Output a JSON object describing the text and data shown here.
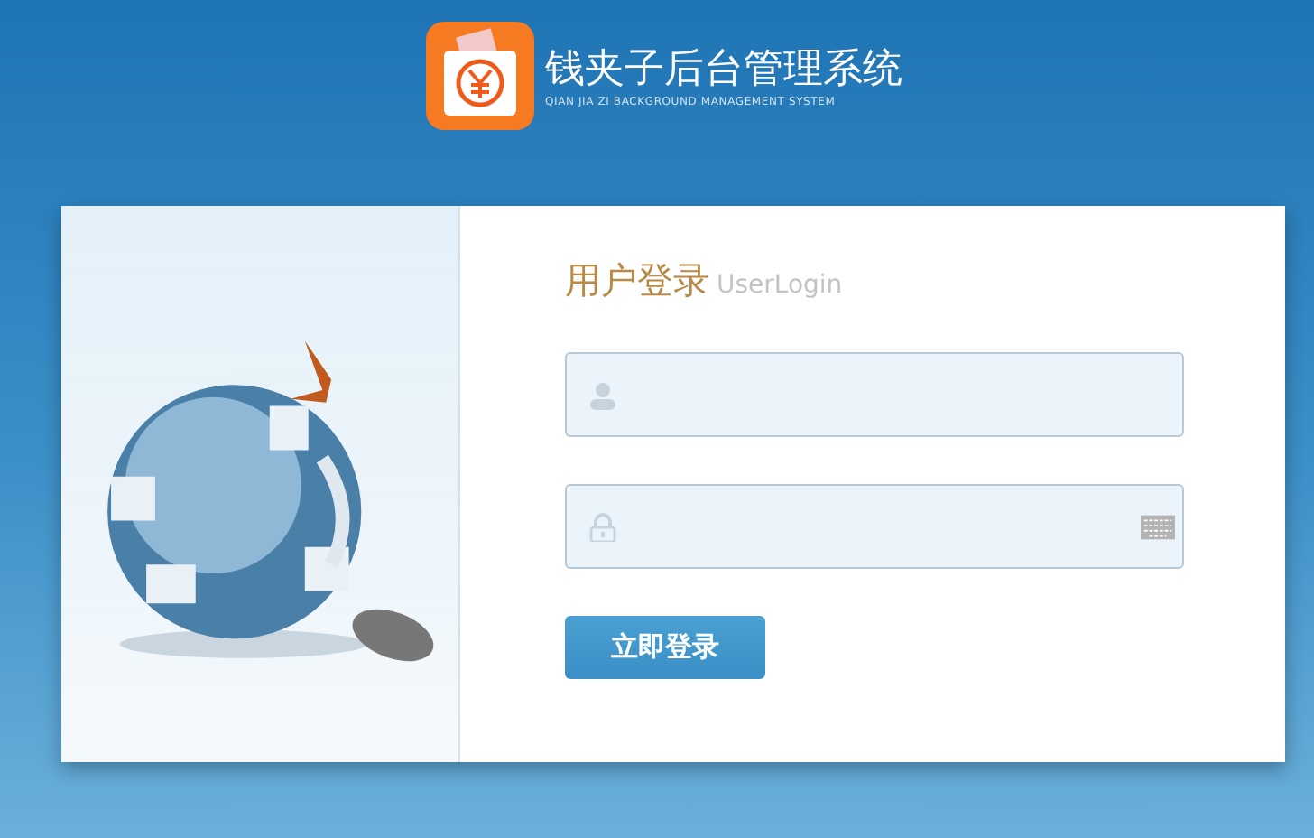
{
  "header": {
    "title": "钱夹子后台管理系统",
    "subtitle": "QIAN JIA ZI BACKGROUND MANAGEMENT SYSTEM"
  },
  "login": {
    "title": "用户登录",
    "title_en": "UserLogin",
    "fields": [
      {
        "kind": "user"
      },
      {
        "kind": "password"
      }
    ],
    "button": "立即登录"
  }
}
